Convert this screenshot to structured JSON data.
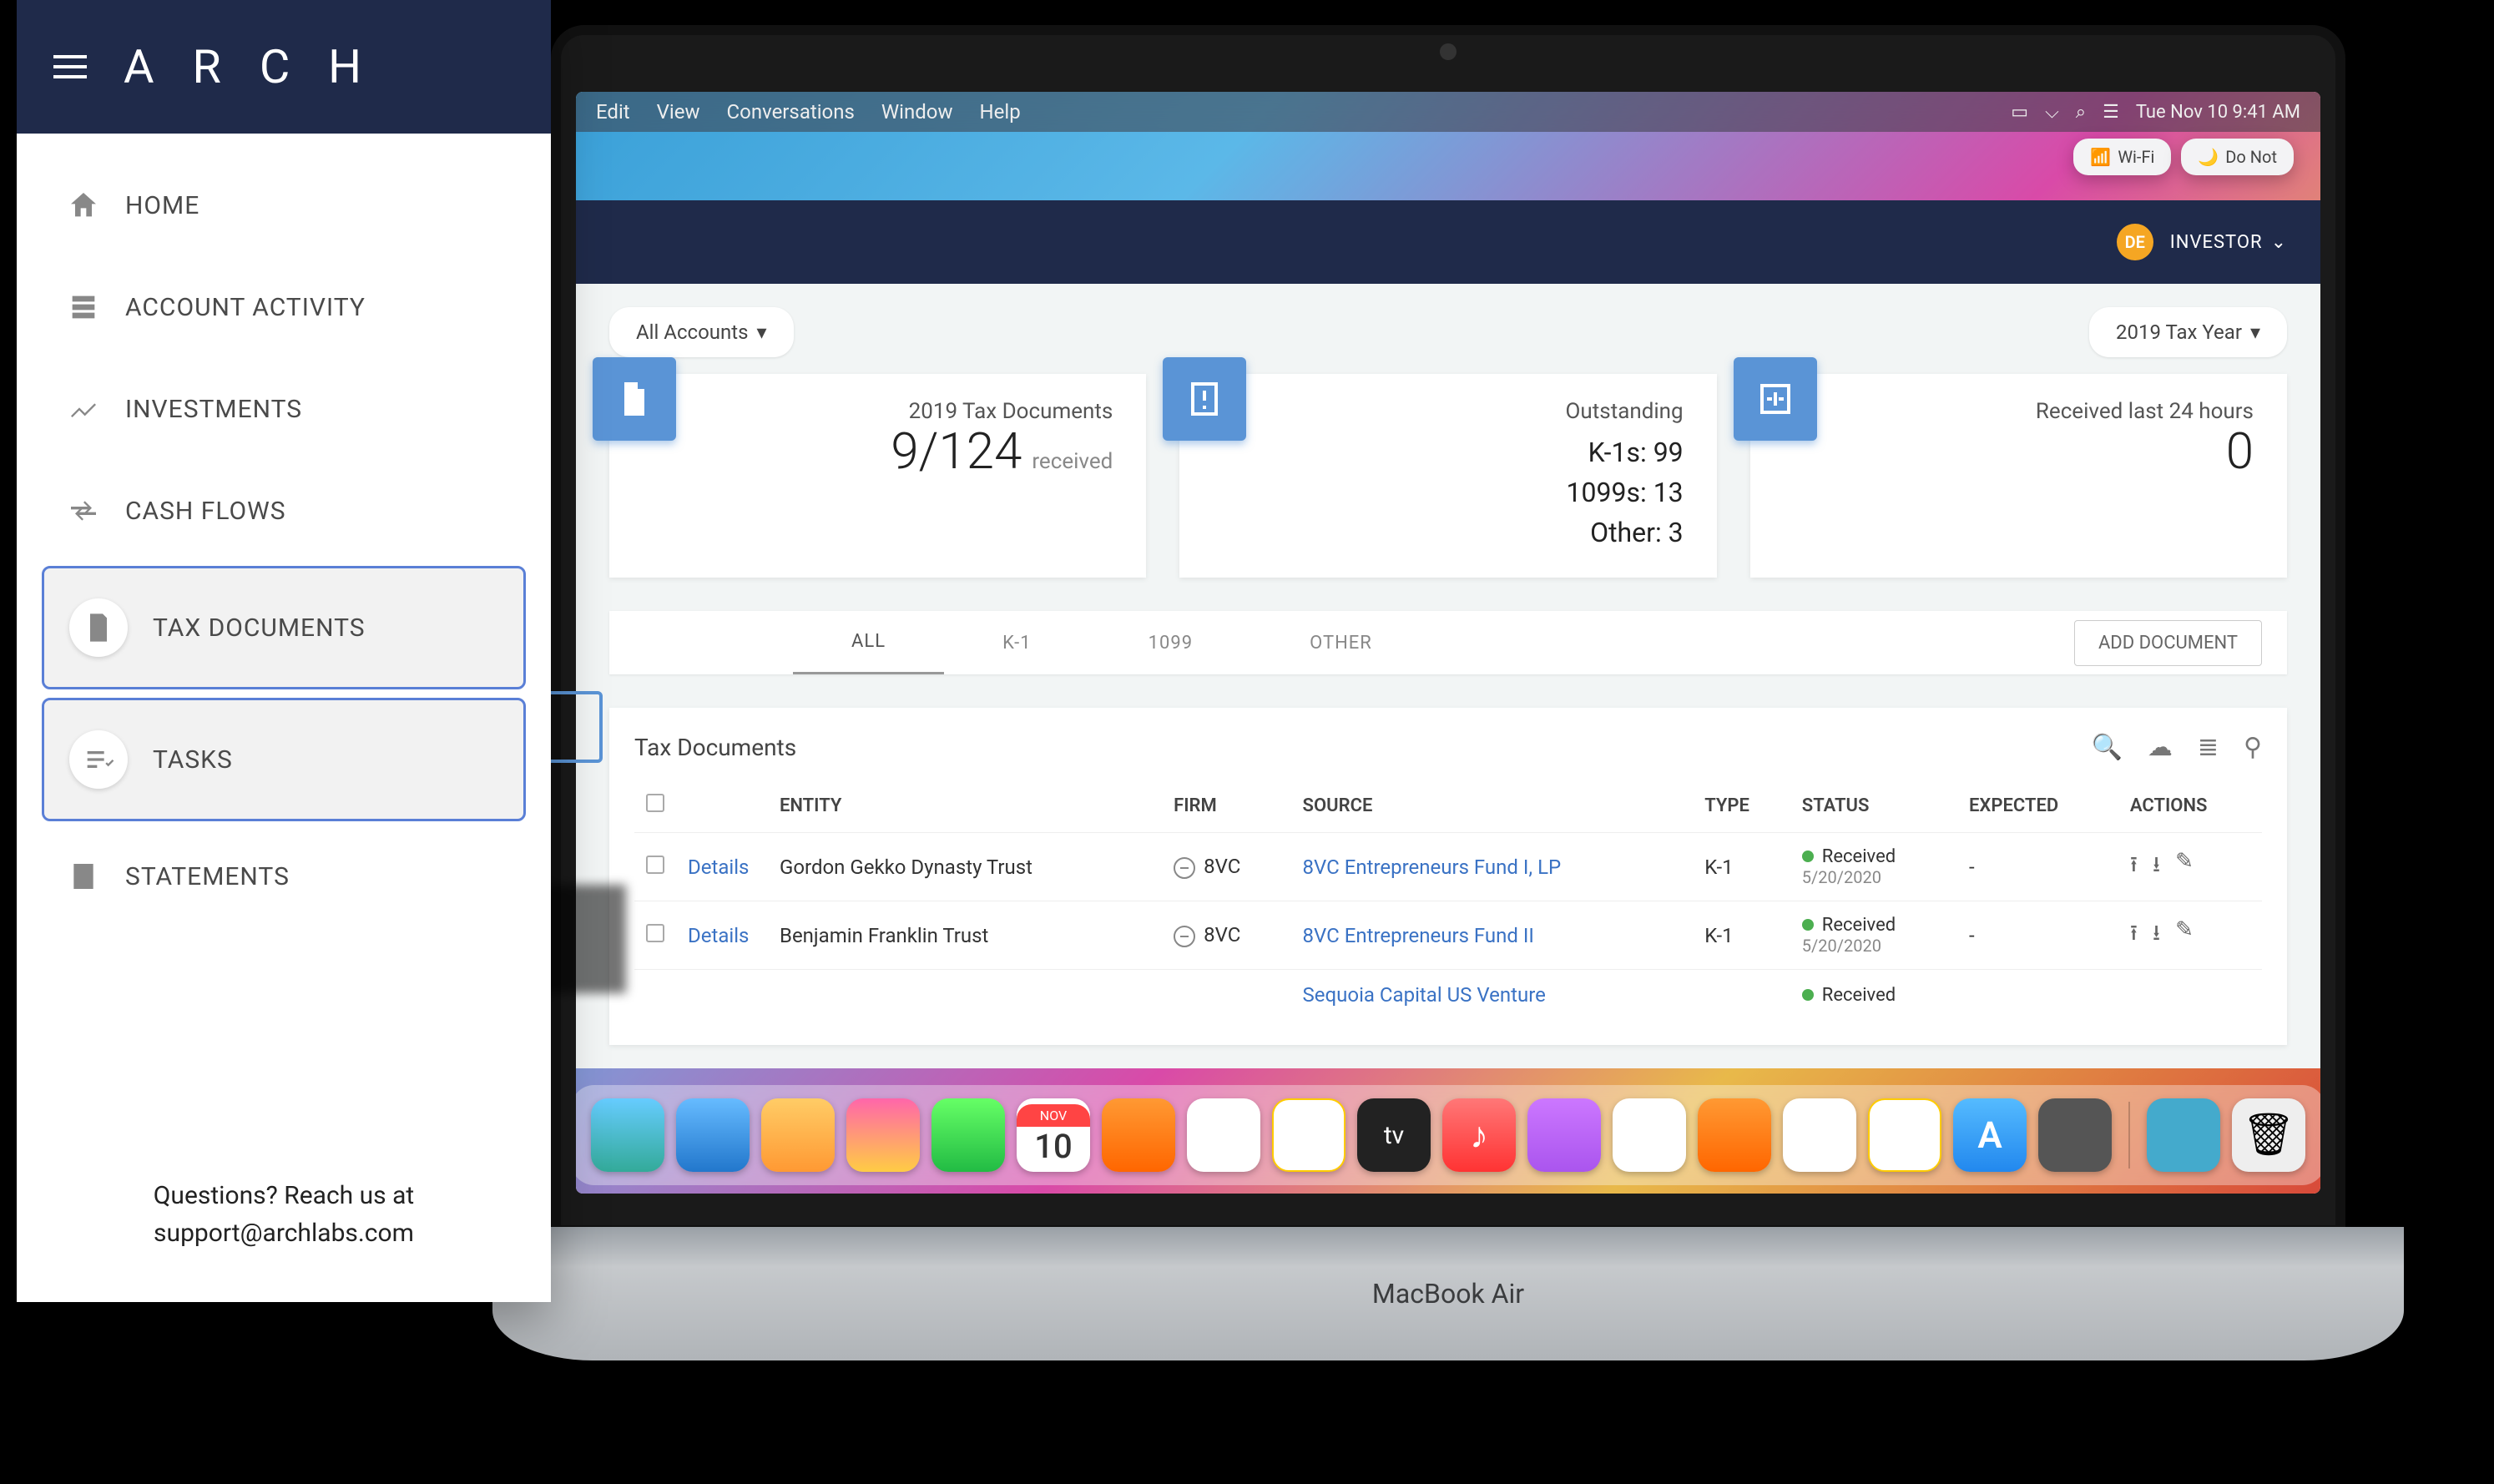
{
  "os": {
    "menu_items": [
      "Edit",
      "View",
      "Conversations",
      "Window",
      "Help"
    ],
    "clock": "Tue Nov 10  9:41 AM",
    "control_center": {
      "wifi": "Wi-Fi",
      "dnd": "Do Not"
    }
  },
  "laptop_label": "MacBook Air",
  "dock_calendar": {
    "month": "NOV",
    "day": "10"
  },
  "dock_tv": "tv",
  "dock_store": "A",
  "sidebar": {
    "brand": "A R C H",
    "items": [
      {
        "label": "HOME",
        "icon": "home",
        "selected": false
      },
      {
        "label": "ACCOUNT ACTIVITY",
        "icon": "activity",
        "selected": false
      },
      {
        "label": "INVESTMENTS",
        "icon": "trend",
        "selected": false
      },
      {
        "label": "CASH FLOWS",
        "icon": "flow",
        "selected": false
      },
      {
        "label": "TAX DOCUMENTS",
        "icon": "doc",
        "selected": true
      },
      {
        "label": "TASKS",
        "icon": "tasks",
        "selected": true
      },
      {
        "label": "STATEMENTS",
        "icon": "statement",
        "selected": false
      }
    ],
    "footer_l1": "Questions? Reach us at",
    "footer_l2": "support@archlabs.com"
  },
  "app": {
    "user": {
      "initials": "DE",
      "role": "INVESTOR"
    },
    "filters": {
      "accounts": "All Accounts",
      "year": "2019 Tax Year"
    },
    "cards": {
      "received": {
        "title": "2019 Tax Documents",
        "value": "9/124",
        "suffix": "received"
      },
      "outstanding": {
        "title": "Outstanding",
        "l1": "K-1s: 99",
        "l2": "1099s: 13",
        "l3": "Other: 3"
      },
      "recent": {
        "title": "Received last 24 hours",
        "value": "0"
      }
    },
    "tabs": [
      "ALL",
      "K-1",
      "1099",
      "OTHER"
    ],
    "add_doc": "ADD DOCUMENT",
    "table": {
      "title": "Tax Documents",
      "columns": [
        "",
        "",
        "ENTITY",
        "FIRM",
        "SOURCE",
        "TYPE",
        "STATUS",
        "EXPECTED",
        "ACTIONS"
      ],
      "rows": [
        {
          "details": "Details",
          "entity": "Gordon Gekko Dynasty Trust",
          "firm": "8VC",
          "source": "8VC Entrepreneurs Fund I, LP",
          "type": "K-1",
          "status": "Received",
          "status_date": "5/20/2020",
          "expected": "-"
        },
        {
          "details": "Details",
          "entity": "Benjamin Franklin Trust",
          "firm": "8VC",
          "source": "8VC Entrepreneurs Fund II",
          "type": "K-1",
          "status": "Received",
          "status_date": "5/20/2020",
          "expected": "-"
        }
      ],
      "overflow_source": "Sequoia Capital US Venture",
      "overflow_status": "Received"
    }
  }
}
